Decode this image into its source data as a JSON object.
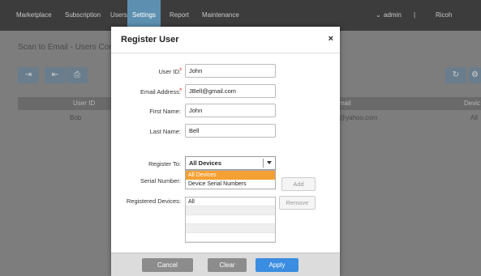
{
  "nav": {
    "items": [
      "Marketplace",
      "Subscription",
      "Users",
      "Settings",
      "Report",
      "Maintenance"
    ],
    "user": "admin",
    "separator": "|",
    "app": "Ricoh Applicatio"
  },
  "page": {
    "title": "Scan to Email - Users Confi",
    "columns": {
      "user_id": "User ID",
      "email": "mail",
      "device": "Devic"
    },
    "rows": [
      {
        "user_id": "Bob",
        "email": "@yahoo.com",
        "device": "All"
      }
    ]
  },
  "dialog": {
    "title": "Register User",
    "close": "×",
    "required_mark": "*",
    "fields": {
      "user_id": {
        "label": "User ID:",
        "value": "John"
      },
      "email": {
        "label": "Email Address:",
        "value": "JBell@gmail.com"
      },
      "first_name": {
        "label": "First Name:",
        "value": "John"
      },
      "last_name": {
        "label": "Last Name:",
        "value": "Bell"
      }
    },
    "register_to": {
      "label": "Register To:",
      "selected": "All Devices",
      "options": [
        "All Devices",
        "Device Serial Numbers"
      ]
    },
    "serial_number": {
      "label": "Serial Number:",
      "add": "Add"
    },
    "registered_devices": {
      "label": "Registered Devices:",
      "items": [
        "All",
        "",
        "",
        "",
        ""
      ],
      "remove": "Remove"
    },
    "footer": {
      "cancel": "Cancel",
      "clear": "Clear",
      "apply": "Apply"
    }
  },
  "colors": {
    "nav_bg": "#3c3c3c",
    "nav_active": "#5d90b0",
    "accent": "#3a8de0",
    "dropdown_highlight": "#f5a032",
    "required": "#e0453a"
  }
}
